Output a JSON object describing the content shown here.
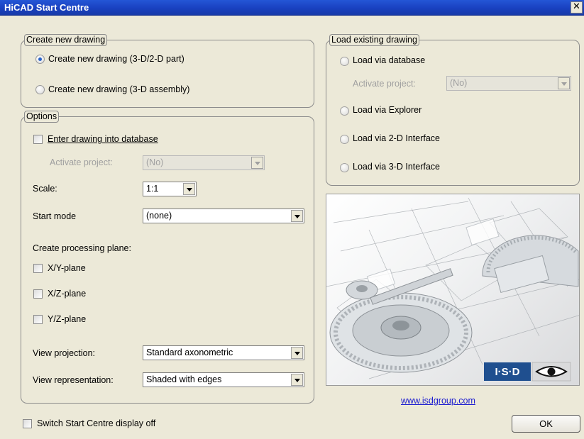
{
  "window": {
    "title": "HiCAD Start Centre",
    "close_glyph": "✕"
  },
  "create_group": {
    "legend": "Create new drawing",
    "options": [
      {
        "label": "Create new drawing (3-D/2-D part)",
        "checked": true
      },
      {
        "label": "Create new drawing (3-D assembly)",
        "checked": false
      }
    ]
  },
  "options_group": {
    "legend": "Options",
    "enter_db": {
      "label": "Enter drawing into database",
      "checked": false
    },
    "activate_project": {
      "label": "Activate project:",
      "value": "(No)"
    },
    "scale": {
      "label": "Scale:",
      "value": "1:1"
    },
    "start_mode": {
      "label": "Start mode",
      "value": "(none)"
    },
    "processing_plane": {
      "label": "Create processing plane:",
      "planes": [
        "X/Y-plane",
        "X/Z-plane",
        "Y/Z-plane"
      ]
    },
    "view_projection": {
      "label": "View projection:",
      "value": "Standard axonometric"
    },
    "view_representation": {
      "label": "View representation:",
      "value": "Shaded with edges"
    }
  },
  "load_group": {
    "legend": "Load existing drawing",
    "via_database": "Load via database",
    "activate_project": {
      "label": "Activate project:",
      "value": "(No)"
    },
    "via_explorer": "Load via Explorer",
    "via_2d": "Load via 2-D Interface",
    "via_3d": "Load via 3-D Interface"
  },
  "image": {
    "logo_text": "I·S·D"
  },
  "link": "www.isdgroup.com",
  "footer": {
    "switch_off_label": "Switch Start Centre display off",
    "ok_label": "OK"
  },
  "colors": {
    "title_bar": "#1941c0",
    "dialog_bg": "#ece9d8",
    "link": "#1a1ad0",
    "logo_bg": "#1f4f8f"
  }
}
